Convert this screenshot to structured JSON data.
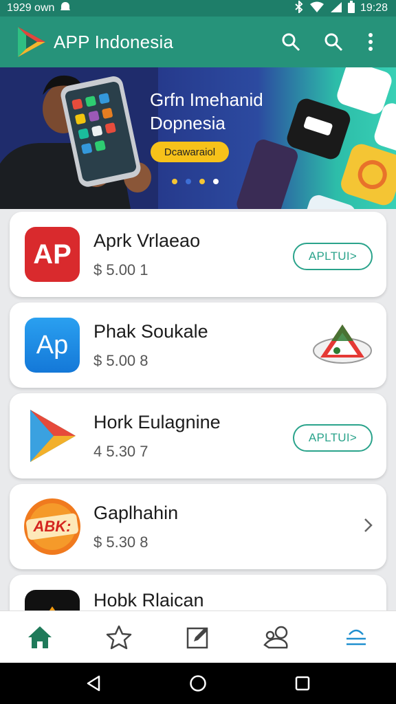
{
  "status_bar": {
    "time_left": "1929 own",
    "time_right": "19:28"
  },
  "app_bar": {
    "title": "APP Indonesia"
  },
  "banner": {
    "headline": "Grfn Imehanid Dopnesia",
    "cta": "Dcawaraiol"
  },
  "apps": [
    {
      "name": "Aprk Vrlaeao",
      "price": "$ 5.00  1",
      "icon_text": "AP",
      "action": "APLTUI>"
    },
    {
      "name": "Phak Soukale",
      "price": "$ 5.00  8",
      "icon_text": "Ap"
    },
    {
      "name": "Hork Eulagnine",
      "price": "4  5.30  7",
      "action": "APLTUI>"
    },
    {
      "name": "Gaplhahin",
      "price": "$ 5.30  8",
      "icon_text": "ABK:"
    },
    {
      "name": "Hobk Rlaican"
    }
  ],
  "colors": {
    "primary": "#26937a",
    "status": "#1e7e69",
    "accent": "#f7c21a",
    "outline": "#2aa38b"
  }
}
